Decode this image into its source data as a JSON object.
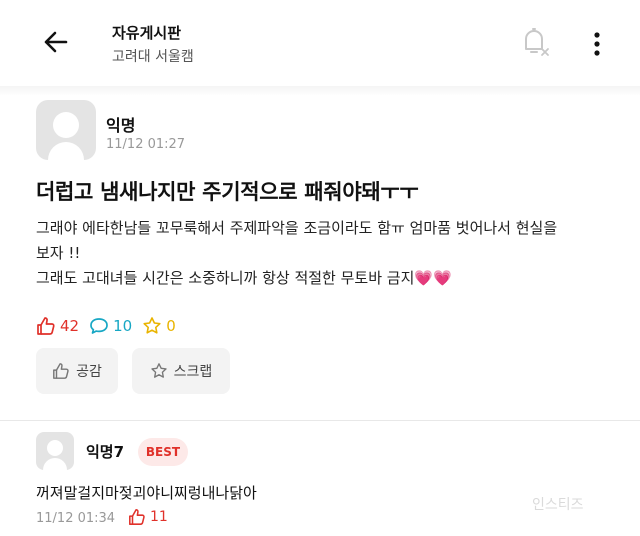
{
  "header": {
    "title": "자유게시판",
    "subtitle": "고려대 서울캠",
    "back_icon": "arrow-left-icon",
    "notification_icon": "bell-off-icon",
    "more_icon": "more-vertical-icon"
  },
  "post": {
    "author": "익명",
    "time": "11/12 01:27",
    "title": "더럽고 냄새나지만 주기적으로 패줘야돼ㅜㅜ",
    "body_lines": [
      "그래야 에타한남들 꼬무룩해서 주제파악을 조금이라도 함ㅠ 엄마품 벗어나서 현실을",
      "보자 !!",
      "그래도 고대녀들 시간은 소중하니까 항상 적절한 무토바 금지💗💗"
    ],
    "likes": "42",
    "comments": "10",
    "scraps": "0",
    "like_button": "공감",
    "scrap_button": "스크랩"
  },
  "comment": {
    "author": "익명7",
    "badge": "BEST",
    "text": "꺼져말걸지마젖괴야니찌렁내나닭아",
    "time": "11/12 01:34",
    "likes": "11"
  },
  "watermark": "인스티즈",
  "colors": {
    "accent_red": "#e0312a",
    "comment_teal": "#17a7c4",
    "scrap_yellow": "#e9b400"
  }
}
